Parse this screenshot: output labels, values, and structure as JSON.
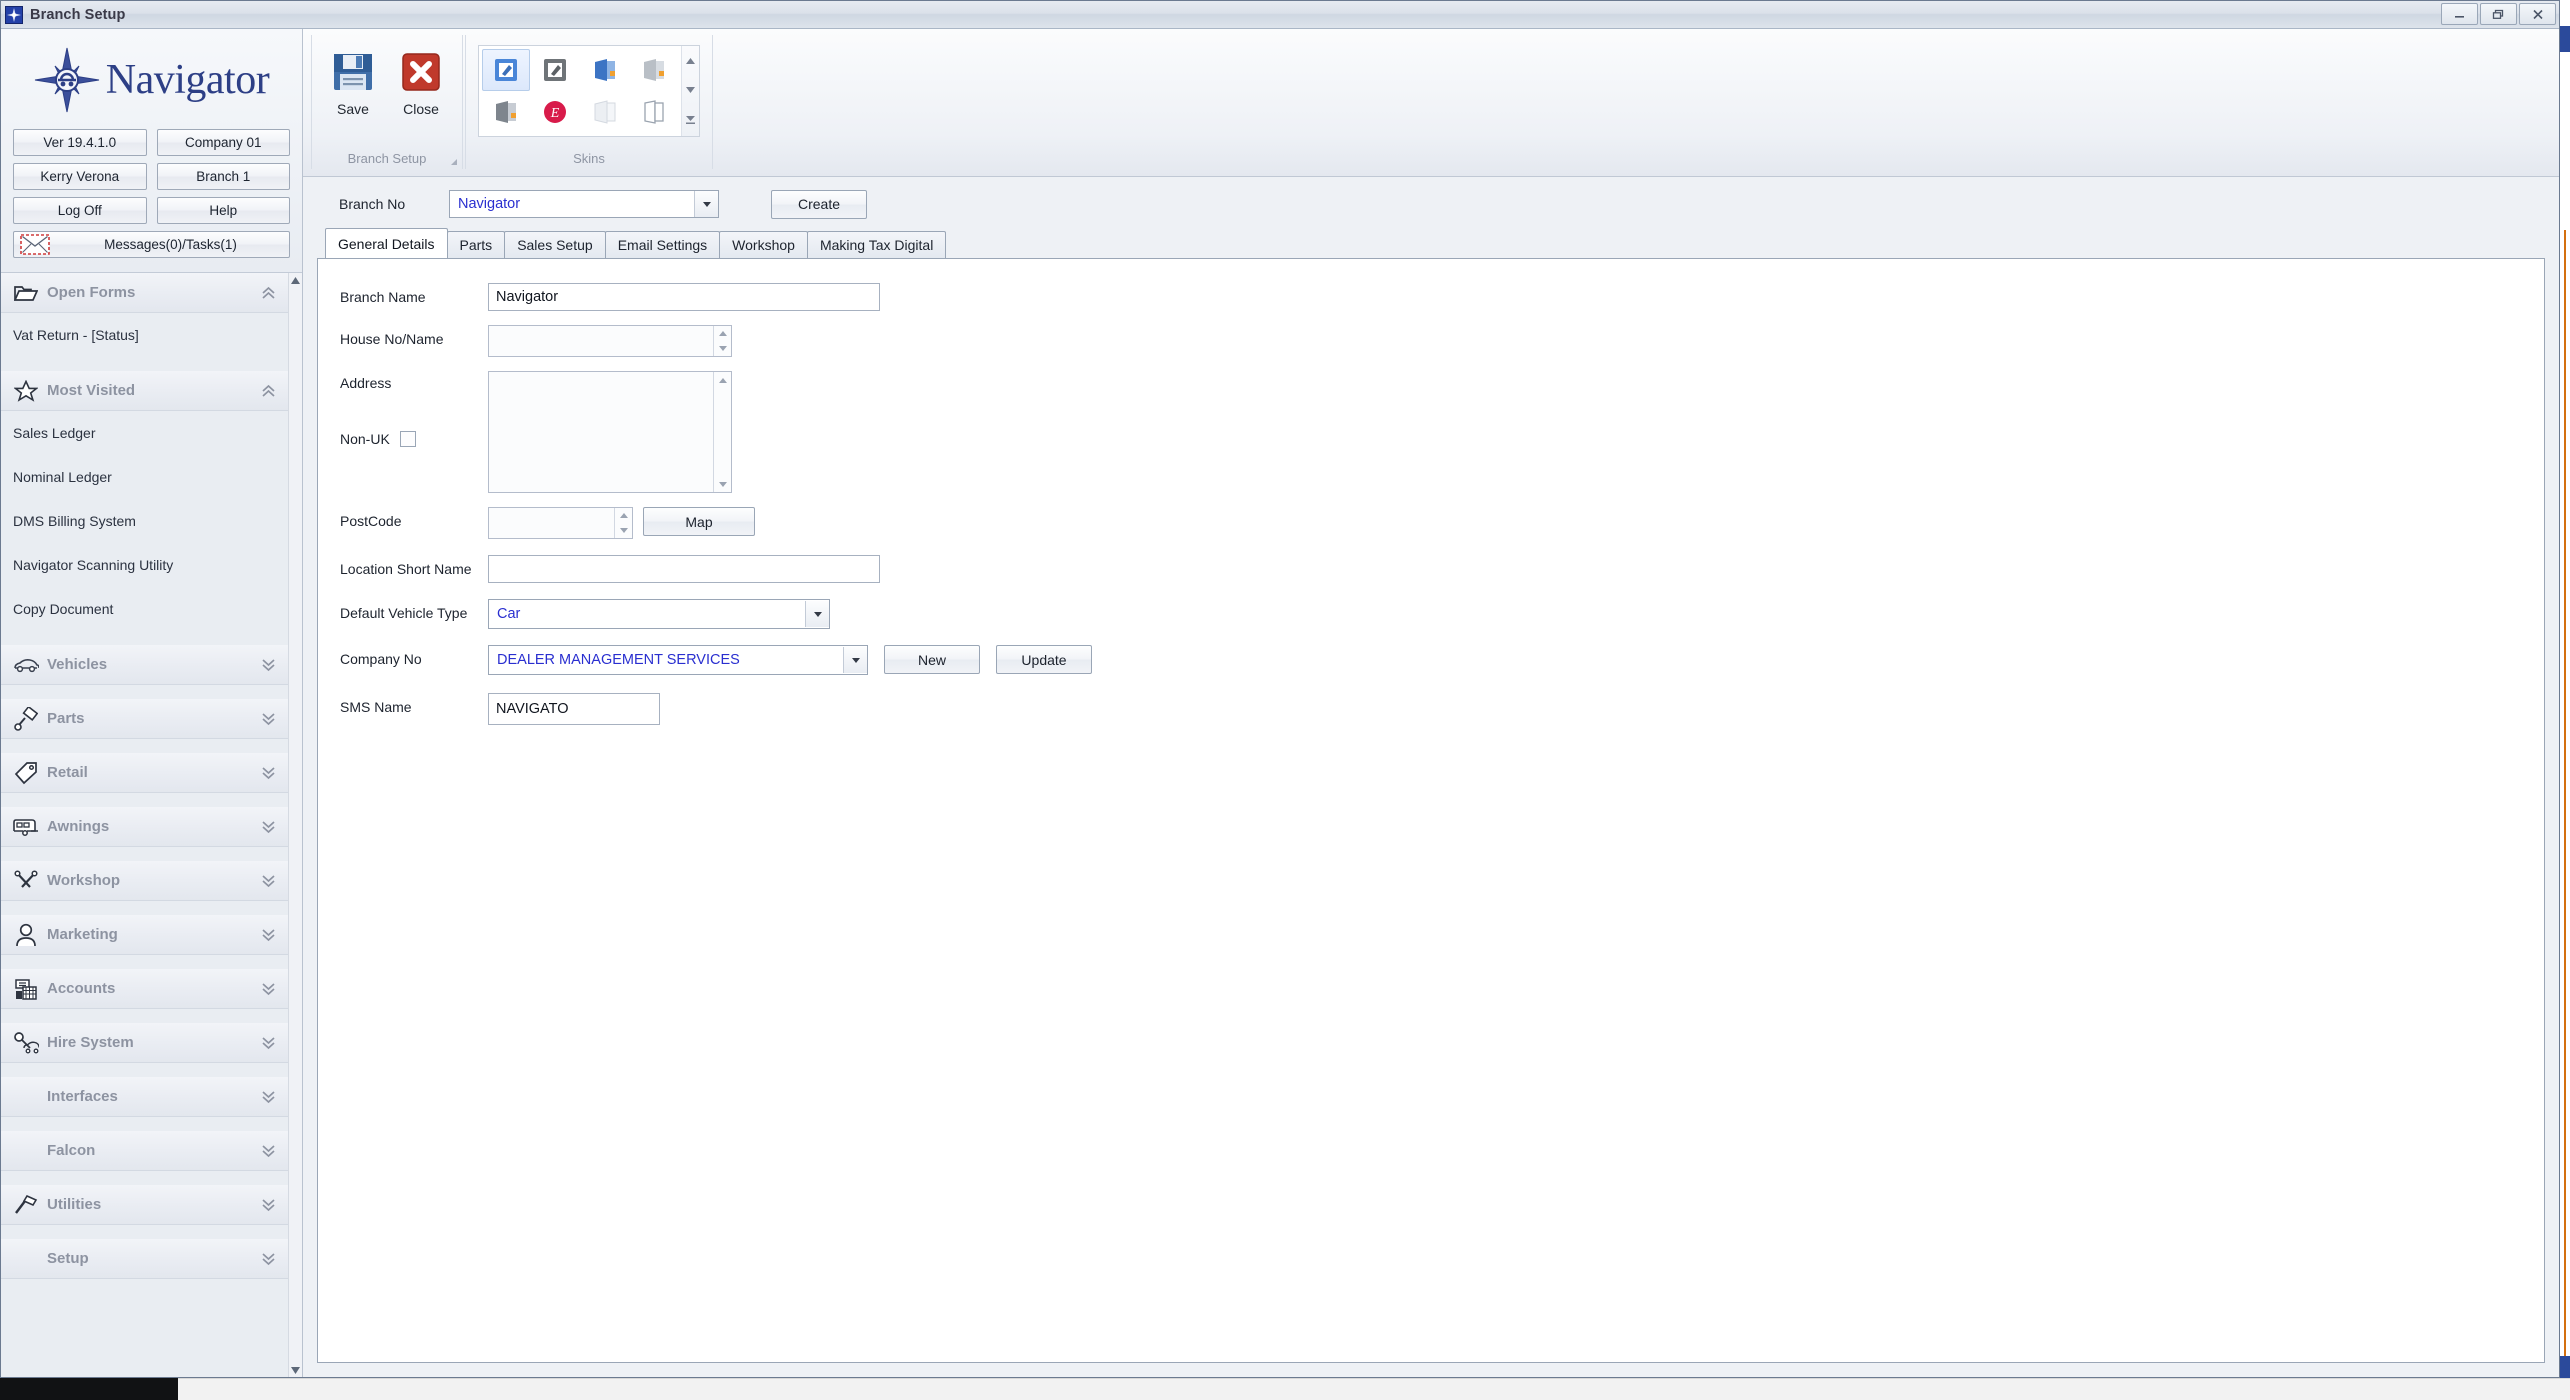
{
  "window": {
    "title": "Branch Setup",
    "icon": "navigator-compass-icon",
    "minimize_label": "Minimize",
    "restore_label": "Restore",
    "close_label": "Close"
  },
  "nav_header": {
    "logo_text": "Navigator",
    "buttons": [
      {
        "name": "version-button",
        "label": "Ver 19.4.1.0"
      },
      {
        "name": "company-button",
        "label": "Company 01"
      },
      {
        "name": "user-button",
        "label": "Kerry Verona"
      },
      {
        "name": "branch-button",
        "label": "Branch 1"
      },
      {
        "name": "logoff-button",
        "label": "Log Off"
      },
      {
        "name": "help-button",
        "label": "Help"
      }
    ],
    "messages_button": {
      "name": "messages-tasks-button",
      "label": "Messages(0)/Tasks(1)"
    }
  },
  "sidebar": {
    "groups": [
      {
        "name": "open-forms",
        "title": "Open Forms",
        "icon": "folder-icon",
        "chevron": "chevron-up-double-icon",
        "items": [
          {
            "label": "Vat Return - [Status]"
          }
        ]
      },
      {
        "name": "most-visited",
        "title": "Most Visited",
        "icon": "star-icon",
        "chevron": "chevron-up-double-icon",
        "items": [
          {
            "label": "Sales Ledger"
          },
          {
            "label": "Nominal Ledger"
          },
          {
            "label": "DMS Billing System"
          },
          {
            "label": "Navigator Scanning Utility"
          },
          {
            "label": "Copy Document"
          }
        ]
      },
      {
        "name": "vehicles",
        "title": "Vehicles",
        "icon": "car-icon",
        "chevron": "chevron-down-double-icon",
        "items": []
      },
      {
        "name": "parts",
        "title": "Parts",
        "icon": "piston-icon",
        "chevron": "chevron-down-double-icon",
        "items": []
      },
      {
        "name": "retail",
        "title": "Retail",
        "icon": "tag-icon",
        "chevron": "chevron-down-double-icon",
        "items": []
      },
      {
        "name": "awnings",
        "title": "Awnings",
        "icon": "caravan-icon",
        "chevron": "chevron-down-double-icon",
        "items": []
      },
      {
        "name": "workshop",
        "title": "Workshop",
        "icon": "tools-icon",
        "chevron": "chevron-down-double-icon",
        "items": []
      },
      {
        "name": "marketing",
        "title": "Marketing",
        "icon": "person-icon",
        "chevron": "chevron-down-double-icon",
        "items": []
      },
      {
        "name": "accounts",
        "title": "Accounts",
        "icon": "calculator-icon",
        "chevron": "chevron-down-double-icon",
        "items": []
      },
      {
        "name": "hire-system",
        "title": "Hire System",
        "icon": "key-car-icon",
        "chevron": "chevron-down-double-icon",
        "items": []
      },
      {
        "name": "interfaces",
        "title": "Interfaces",
        "icon": "",
        "chevron": "chevron-down-double-icon",
        "items": []
      },
      {
        "name": "falcon",
        "title": "Falcon",
        "icon": "",
        "chevron": "chevron-down-double-icon",
        "items": []
      },
      {
        "name": "utilities",
        "title": "Utilities",
        "icon": "hammer-icon",
        "chevron": "chevron-down-double-icon",
        "items": []
      },
      {
        "name": "setup",
        "title": "Setup",
        "icon": "",
        "chevron": "chevron-down-double-icon",
        "items": []
      }
    ]
  },
  "ribbon": {
    "groups": [
      {
        "name": "branch-setup-group",
        "caption": "Branch Setup",
        "buttons": [
          {
            "name": "save-button",
            "label": "Save",
            "icon": "floppy-disk-icon"
          },
          {
            "name": "close-button",
            "label": "Close",
            "icon": "red-x-icon"
          }
        ]
      },
      {
        "name": "skins-group",
        "caption": "Skins",
        "items": [
          {
            "name": "skin-blue-edit",
            "icon": "blue-edit-square-icon",
            "selected": true
          },
          {
            "name": "skin-grey-edit",
            "icon": "grey-edit-square-icon",
            "selected": false
          },
          {
            "name": "skin-office-blue",
            "icon": "office-blue-icon",
            "selected": false
          },
          {
            "name": "skin-office-grey",
            "icon": "office-grey-icon",
            "selected": false
          },
          {
            "name": "skin-office-dark",
            "icon": "office-dark-icon",
            "selected": false
          },
          {
            "name": "skin-red-circle",
            "icon": "red-circle-e-icon",
            "selected": false
          },
          {
            "name": "skin-office-light",
            "icon": "office-light-icon",
            "selected": false
          },
          {
            "name": "skin-office-plain",
            "icon": "office-plain-icon",
            "selected": false
          }
        ]
      }
    ]
  },
  "main": {
    "branch_no": {
      "label": "Branch No",
      "value": "Navigator",
      "create_label": "Create"
    },
    "tabs": [
      {
        "label": "General Details",
        "active": true
      },
      {
        "label": "Parts",
        "active": false
      },
      {
        "label": "Sales Setup",
        "active": false
      },
      {
        "label": "Email Settings",
        "active": false
      },
      {
        "label": "Workshop",
        "active": false
      },
      {
        "label": "Making Tax Digital",
        "active": false
      }
    ],
    "fields": {
      "branch_name": {
        "label": "Branch Name",
        "value": "Navigator"
      },
      "house_no": {
        "label": "House No/Name",
        "value": ""
      },
      "address": {
        "label": "Address",
        "value": ""
      },
      "non_uk": {
        "label": "Non-UK",
        "checked": false
      },
      "postcode": {
        "label": "PostCode",
        "value": ""
      },
      "map_button": {
        "label": "Map"
      },
      "location_short_name": {
        "label": "Location Short Name",
        "value": ""
      },
      "default_vehicle_type": {
        "label": "Default Vehicle Type",
        "value": "Car"
      },
      "company_no": {
        "label": "Company No",
        "value": "DEALER MANAGEMENT SERVICES"
      },
      "new_button": {
        "label": "New"
      },
      "update_button": {
        "label": "Update"
      },
      "sms_name": {
        "label": "SMS Name",
        "value": "NAVIGATO"
      }
    }
  },
  "colors": {
    "brand_blue": "#2d3f86",
    "value_blue": "#2a2fd0",
    "window_bg": "#eef1f5",
    "nav_bg": "#e9edf2"
  }
}
